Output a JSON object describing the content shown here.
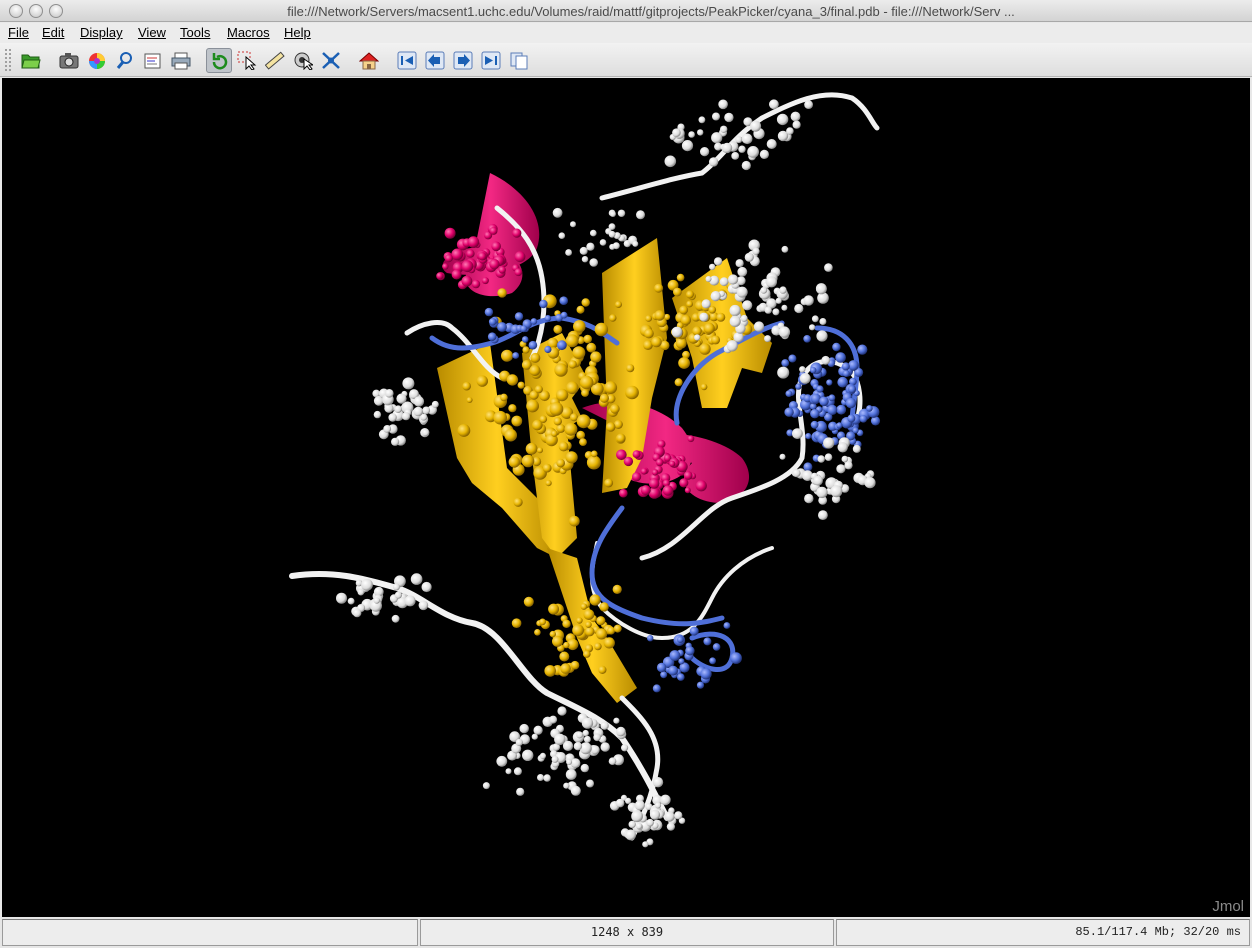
{
  "window": {
    "title": "file:///Network/Servers/macsent1.uchc.edu/Volumes/raid/mattf/gitprojects/PeakPicker/cyana_3/final.pdb - file:///Network/Serv ..."
  },
  "menubar": {
    "items": [
      {
        "label": "File"
      },
      {
        "label": "Edit"
      },
      {
        "label": "Display"
      },
      {
        "label": "View"
      },
      {
        "label": "Tools"
      },
      {
        "label": "Macros"
      },
      {
        "label": "Help"
      }
    ]
  },
  "toolbar": {
    "icons": [
      "open-icon",
      "screenshot-icon",
      "color-wheel-icon",
      "inspect-icon",
      "editor-icon",
      "print-icon",
      "rotate-icon",
      "select-icon",
      "measure-icon",
      "pick-center-icon",
      "spin-icon",
      "home-icon",
      "first-frame-icon",
      "prev-frame-icon",
      "next-frame-icon",
      "last-frame-icon",
      "copy-icon"
    ]
  },
  "viewer": {
    "watermark": "Jmol",
    "colors": {
      "background": "#000000",
      "strand": "#e6b400",
      "helix": "#e0006a",
      "coil": "#ffffff",
      "blue": "#4f6fd8"
    }
  },
  "statusbar": {
    "left": "",
    "dimensions": "1248 x 839",
    "memory": "85.1/117.4 Mb;  32/20 ms"
  }
}
